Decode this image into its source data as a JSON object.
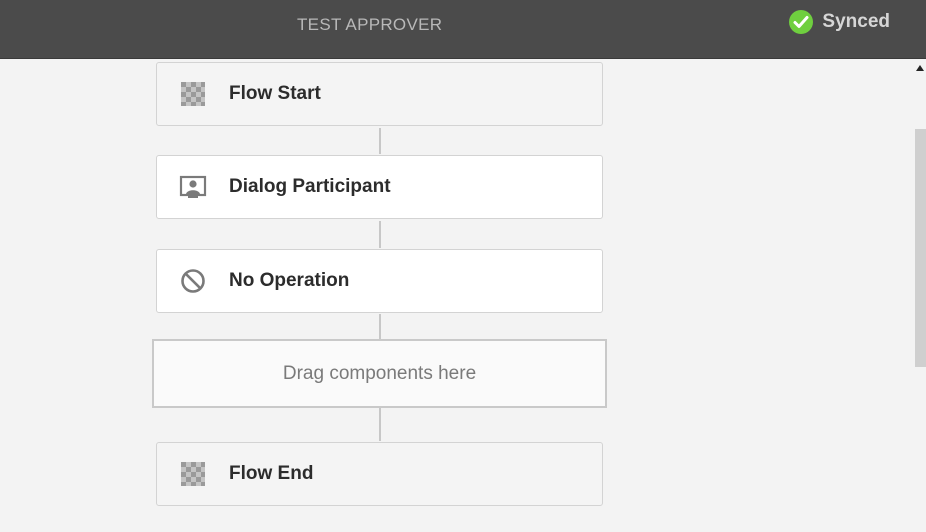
{
  "header": {
    "title": "TEST APPROVER",
    "status_label": "Synced",
    "status_icon": "check-circle-icon",
    "status_color": "#6fcf3f"
  },
  "workflow": {
    "nodes": [
      {
        "label": "Flow Start",
        "icon": "flow-start-icon"
      },
      {
        "label": "Dialog Participant",
        "icon": "dialog-participant-icon"
      },
      {
        "label": "No Operation",
        "icon": "no-operation-icon"
      },
      {
        "label": "Flow End",
        "icon": "flow-end-icon"
      }
    ],
    "dropzone_label": "Drag components here"
  }
}
